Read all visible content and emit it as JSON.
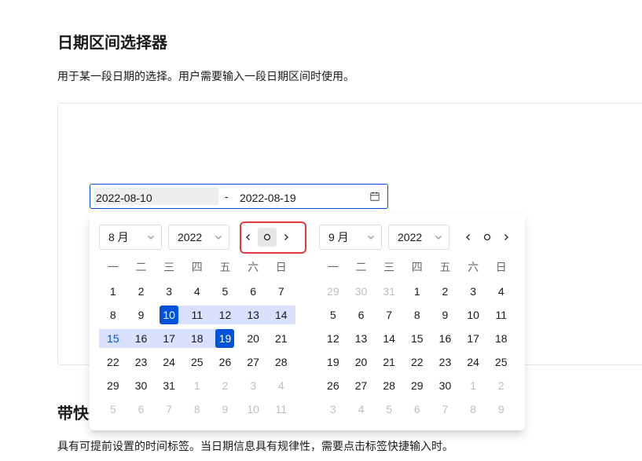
{
  "page": {
    "title": "日期区间选择器",
    "description": "用于某一段日期的选择。用户需要输入一段日期区间时使用。"
  },
  "range_input": {
    "start_value": "2022-08-10",
    "separator": "-",
    "end_value": "2022-08-19",
    "suffix_icon": "calendar-icon"
  },
  "picker": {
    "weekdays": [
      "一",
      "二",
      "三",
      "四",
      "五",
      "六",
      "日"
    ],
    "select_icon": "chevron-down-icon",
    "nav_icons": {
      "prev": "chevron-left-icon",
      "current": "circle-icon",
      "next": "chevron-right-icon"
    },
    "panels": [
      {
        "month": "8 月",
        "year": "2022",
        "weeks": [
          [
            {
              "day": "1"
            },
            {
              "day": "2"
            },
            {
              "day": "3"
            },
            {
              "day": "4"
            },
            {
              "day": "5"
            },
            {
              "day": "6"
            },
            {
              "day": "7"
            }
          ],
          [
            {
              "day": "8"
            },
            {
              "day": "9"
            },
            {
              "day": "10",
              "state": "range-start"
            },
            {
              "day": "11",
              "state": "in-range"
            },
            {
              "day": "12",
              "state": "in-range"
            },
            {
              "day": "13",
              "state": "in-range"
            },
            {
              "day": "14",
              "state": "in-range"
            }
          ],
          [
            {
              "day": "15",
              "state": "in-range-hover"
            },
            {
              "day": "16",
              "state": "in-range"
            },
            {
              "day": "17",
              "state": "in-range"
            },
            {
              "day": "18",
              "state": "in-range"
            },
            {
              "day": "19",
              "state": "range-end"
            },
            {
              "day": "20"
            },
            {
              "day": "21"
            }
          ],
          [
            {
              "day": "22"
            },
            {
              "day": "23"
            },
            {
              "day": "24"
            },
            {
              "day": "25"
            },
            {
              "day": "26"
            },
            {
              "day": "27"
            },
            {
              "day": "28"
            }
          ],
          [
            {
              "day": "29"
            },
            {
              "day": "30"
            },
            {
              "day": "31"
            },
            {
              "day": "1",
              "state": "other-month"
            },
            {
              "day": "2",
              "state": "other-month"
            },
            {
              "day": "3",
              "state": "other-month"
            },
            {
              "day": "4",
              "state": "other-month"
            }
          ],
          [
            {
              "day": "5",
              "state": "other-month"
            },
            {
              "day": "6",
              "state": "other-month"
            },
            {
              "day": "7",
              "state": "other-month"
            },
            {
              "day": "8",
              "state": "other-month"
            },
            {
              "day": "9",
              "state": "other-month"
            },
            {
              "day": "10",
              "state": "other-month"
            },
            {
              "day": "11",
              "state": "other-month"
            }
          ]
        ]
      },
      {
        "month": "9 月",
        "year": "2022",
        "weeks": [
          [
            {
              "day": "29",
              "state": "other-month"
            },
            {
              "day": "30",
              "state": "other-month"
            },
            {
              "day": "31",
              "state": "other-month"
            },
            {
              "day": "1"
            },
            {
              "day": "2"
            },
            {
              "day": "3"
            },
            {
              "day": "4"
            }
          ],
          [
            {
              "day": "5"
            },
            {
              "day": "6"
            },
            {
              "day": "7"
            },
            {
              "day": "8"
            },
            {
              "day": "9"
            },
            {
              "day": "10"
            },
            {
              "day": "11"
            }
          ],
          [
            {
              "day": "12"
            },
            {
              "day": "13"
            },
            {
              "day": "14"
            },
            {
              "day": "15"
            },
            {
              "day": "16"
            },
            {
              "day": "17"
            },
            {
              "day": "18"
            }
          ],
          [
            {
              "day": "19"
            },
            {
              "day": "20"
            },
            {
              "day": "21"
            },
            {
              "day": "22"
            },
            {
              "day": "23"
            },
            {
              "day": "24"
            },
            {
              "day": "25"
            }
          ],
          [
            {
              "day": "26"
            },
            {
              "day": "27"
            },
            {
              "day": "28"
            },
            {
              "day": "29"
            },
            {
              "day": "30"
            },
            {
              "day": "1",
              "state": "other-month"
            },
            {
              "day": "2",
              "state": "other-month"
            }
          ],
          [
            {
              "day": "3",
              "state": "other-month"
            },
            {
              "day": "4",
              "state": "other-month"
            },
            {
              "day": "5",
              "state": "other-month"
            },
            {
              "day": "6",
              "state": "other-month"
            },
            {
              "day": "7",
              "state": "other-month"
            },
            {
              "day": "8",
              "state": "other-month"
            },
            {
              "day": "9",
              "state": "other-month"
            }
          ]
        ]
      }
    ]
  },
  "next_section": {
    "title": "带快",
    "description": "具有可提前设置的时间标签。当日期信息具有规律性，需要点击标签快捷输入时。"
  },
  "colors": {
    "brand": "#0052d9",
    "range": "#d9e1ff",
    "annotation": "#e5393b",
    "active_input": "#eeeeee",
    "hover": "#e7e7e7"
  }
}
